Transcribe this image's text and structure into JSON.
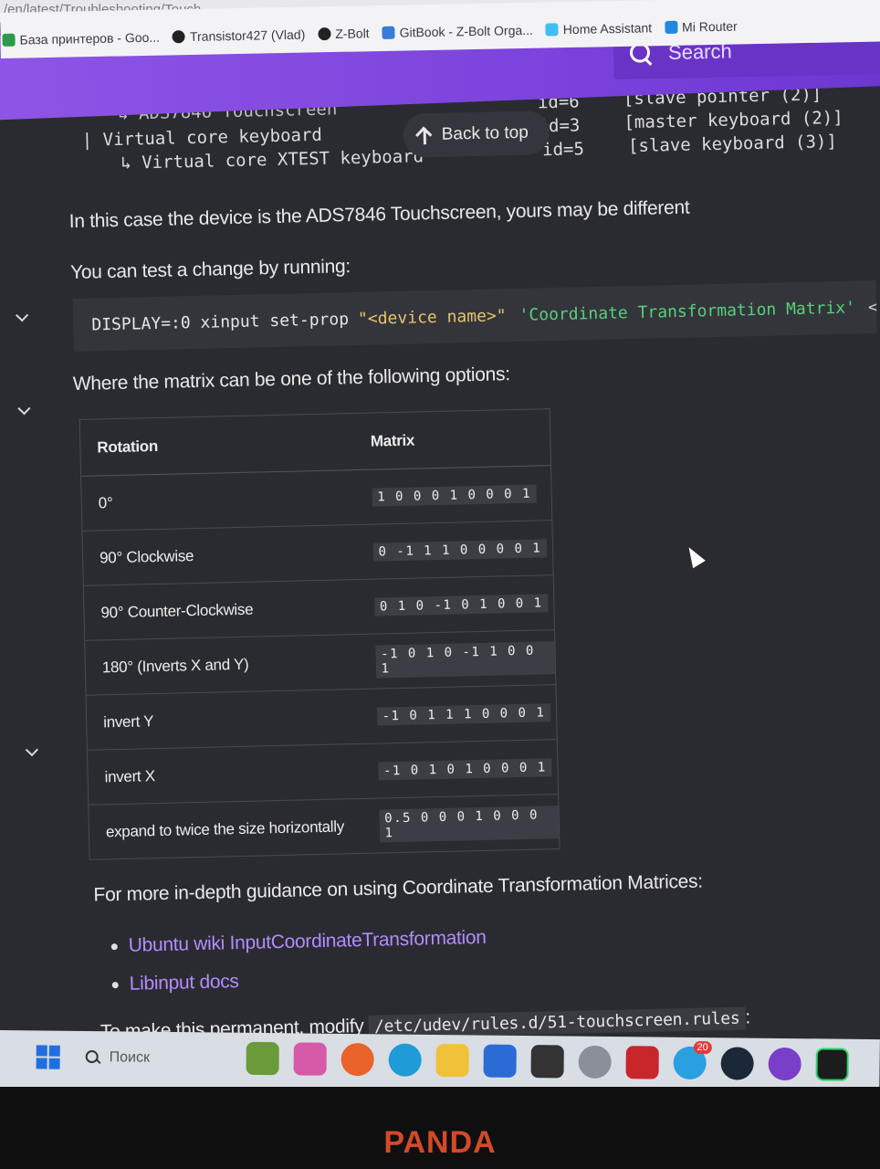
{
  "browser": {
    "url_fragment": "/en/latest/Troubleshooting/Touch...",
    "bookmarks": [
      {
        "label": "База принтеров - Goo...",
        "color": "#2e9b4a"
      },
      {
        "label": "Transistor427 (Vlad)",
        "color": "#222222"
      },
      {
        "label": "Z-Bolt",
        "color": "#222222"
      },
      {
        "label": "GitBook - Z-Bolt Orga...",
        "color": "#3a7bd5"
      },
      {
        "label": "Home Assistant",
        "color": "#41bdf5"
      },
      {
        "label": "Mi Router",
        "color": "#1e88e5"
      }
    ]
  },
  "header": {
    "search_placeholder": "Search",
    "accent": "#7c43dd"
  },
  "code_top": {
    "line1": "↳ ADS7846 Touchscreen",
    "line2": "| Virtual core keyboard",
    "line3": "↳ Virtual core XTEST keyboard",
    "id1": "id=6",
    "id2": "id=3",
    "id3": "id=5",
    "r1": "[slave  pointer  (2)]",
    "r2": "[master keyboard (2)]",
    "r3": "[slave  keyboard (3)]"
  },
  "back_to_top": "Back to top",
  "paragraphs": {
    "device": "In this case the device is the ADS7846 Touchscreen, yours may be different",
    "test": "You can test a change by running:",
    "matrix_intro": "Where the matrix can be one of the following options:",
    "guidance": "For more in-depth guidance on using Coordinate Transformation Matrices:",
    "permanent_prefix": "To make this permanent, modify",
    "permanent_path": "/etc/udev/rules.d/51-touchscreen.rules",
    "permanent_suffix": ":"
  },
  "command": {
    "part1": "DISPLAY=:0 xinput set-prop",
    "part2": "\"<device name>\"",
    "part3": "'Coordinate Transformation Matrix'",
    "part4": "<"
  },
  "table": {
    "headers": [
      "Rotation",
      "Matrix"
    ],
    "rows": [
      {
        "rotation": "0°",
        "matrix": "1 0 0 0 1 0 0 0 1"
      },
      {
        "rotation": "90° Clockwise",
        "matrix": "0 -1 1 1 0 0 0 0 1"
      },
      {
        "rotation": "90° Counter-Clockwise",
        "matrix": "0 1 0 -1 0 1 0 0 1"
      },
      {
        "rotation": "180° (Inverts X and Y)",
        "matrix": "-1 0 1 0 -1 1 0 0 1"
      },
      {
        "rotation": "invert Y",
        "matrix": "-1 0 1 1 1 0 0 0 1"
      },
      {
        "rotation": "invert X",
        "matrix": "-1 0 1 0 1 0 0 0 1"
      },
      {
        "rotation": "expand to twice the size horizontally",
        "matrix": "0.5 0 0 0 1 0 0 0 1"
      }
    ]
  },
  "links": [
    "Ubuntu wiki InputCoordinateTransformation",
    "Libinput docs"
  ],
  "taskbar": {
    "search_label": "Поиск",
    "badge": "20",
    "icons": [
      "game-icon",
      "paint-icon",
      "firefox-icon",
      "edge-icon",
      "files-icon",
      "store-icon",
      "terminal-icon",
      "settings-icon",
      "solidworks-icon",
      "telegram-icon",
      "steam-icon",
      "github-icon",
      "pycharm-icon"
    ]
  },
  "monitor_brand": "PANDA"
}
